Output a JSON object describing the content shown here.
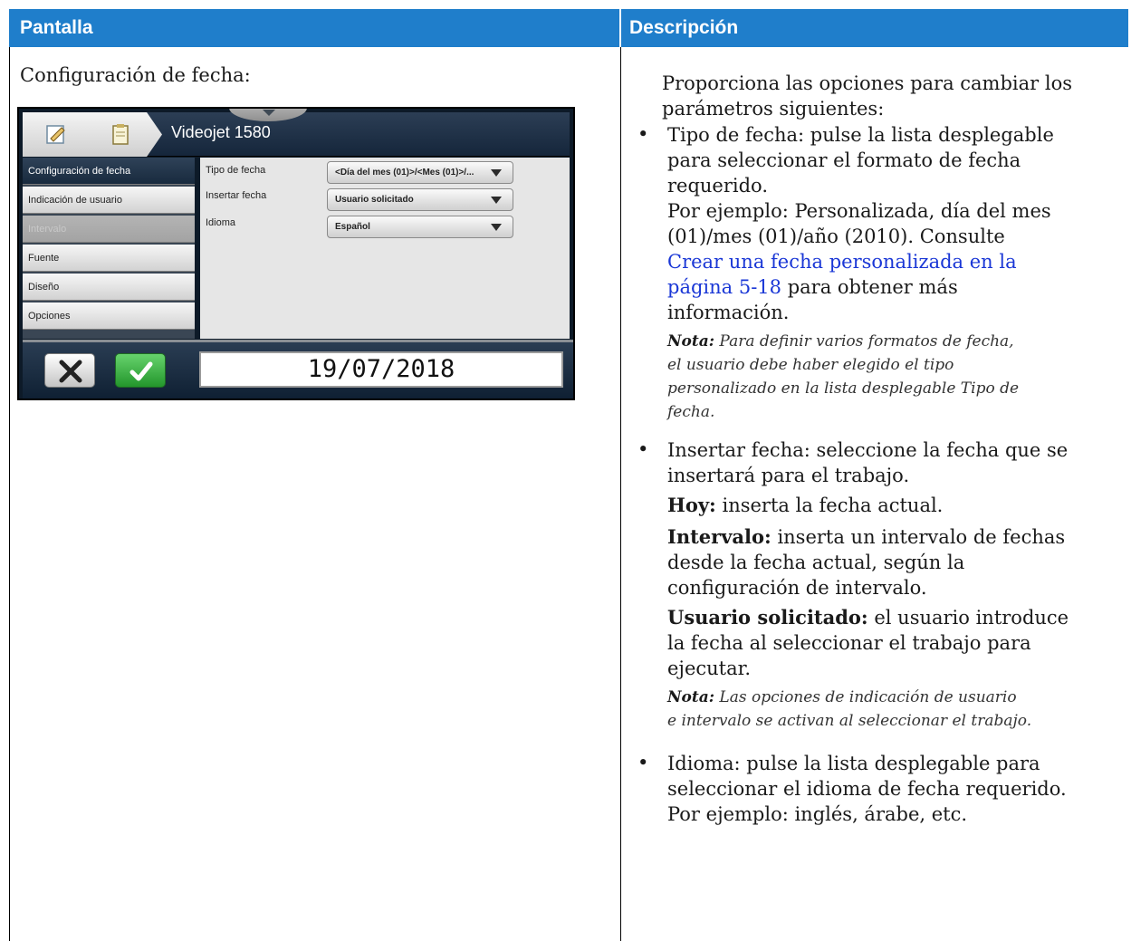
{
  "table": {
    "header_left": "Pantalla",
    "header_right": "Descripción"
  },
  "left": {
    "caption": "Configuración de fecha:",
    "device": {
      "title": "Videojet 1580",
      "sidebar": [
        {
          "label": "Configuración de fecha",
          "state": "active"
        },
        {
          "label": "Indicación de usuario",
          "state": "normal"
        },
        {
          "label": "Intervalo",
          "state": "disabled"
        },
        {
          "label": "Fuente",
          "state": "normal"
        },
        {
          "label": "Diseño",
          "state": "normal"
        },
        {
          "label": "Opciones",
          "state": "normal"
        }
      ],
      "fields": [
        {
          "label": "Tipo de fecha",
          "value": "<Día del mes (01)>/<Mes (01)>/..."
        },
        {
          "label": "Insertar fecha",
          "value": "Usuario solicitado"
        },
        {
          "label": "Idioma",
          "value": "Español"
        }
      ],
      "date_display": "19/07/2018",
      "cancel_icon": "close-icon",
      "ok_icon": "check-icon"
    }
  },
  "right": {
    "intro_line1": "Proporciona las opciones para cambiar los",
    "intro_line2": "parámetros siguientes:",
    "b1_l1": "Tipo de fecha: pulse la lista desplegable",
    "b1_l2": "para seleccionar el formato de fecha",
    "b1_l3": "requerido.",
    "b1_l4": "Por ejemplo: Personalizada, día del mes",
    "b1_l5": "(01)/mes (01)/año (2010). Consulte",
    "b1_link_l1": "Crear una fecha personalizada en la",
    "b1_link_l2": "página 5-18",
    "b1_after_link": " para obtener más",
    "b1_l8": "información.",
    "note1_label": "Nota:",
    "note1_l1": " Para definir varios formatos de fecha,",
    "note1_l2": "el usuario debe haber elegido el tipo",
    "note1_l3": "personalizado en la lista desplegable Tipo de",
    "note1_l4": "fecha.",
    "b2_l1": "Insertar fecha: seleccione la fecha que se",
    "b2_l2": "insertará para el trabajo.",
    "hoy_label": "Hoy:",
    "hoy_text": " inserta la fecha actual.",
    "intervalo_label": "Intervalo:",
    "intervalo_l1": " inserta un intervalo de fechas",
    "intervalo_l2": "desde la fecha actual, según la",
    "intervalo_l3": "configuración de intervalo.",
    "usuario_label": "Usuario solicitado:",
    "usuario_l1": " el usuario introduce",
    "usuario_l2": "la fecha al seleccionar el trabajo para",
    "usuario_l3": "ejecutar.",
    "note2_label": "Nota:",
    "note2_l1": " Las opciones de indicación de usuario",
    "note2_l2": "e intervalo se activan al seleccionar el trabajo.",
    "b3_l1": "Idioma: pulse la lista desplegable para",
    "b3_l2": "seleccionar el idioma de fecha requerido.",
    "b3_l3": "Por ejemplo: inglés, árabe, etc.",
    "bullet": "•"
  },
  "colors": {
    "header_bg": "#1f7ecb",
    "link": "#1a37d6",
    "ok_green": "#23962c"
  }
}
